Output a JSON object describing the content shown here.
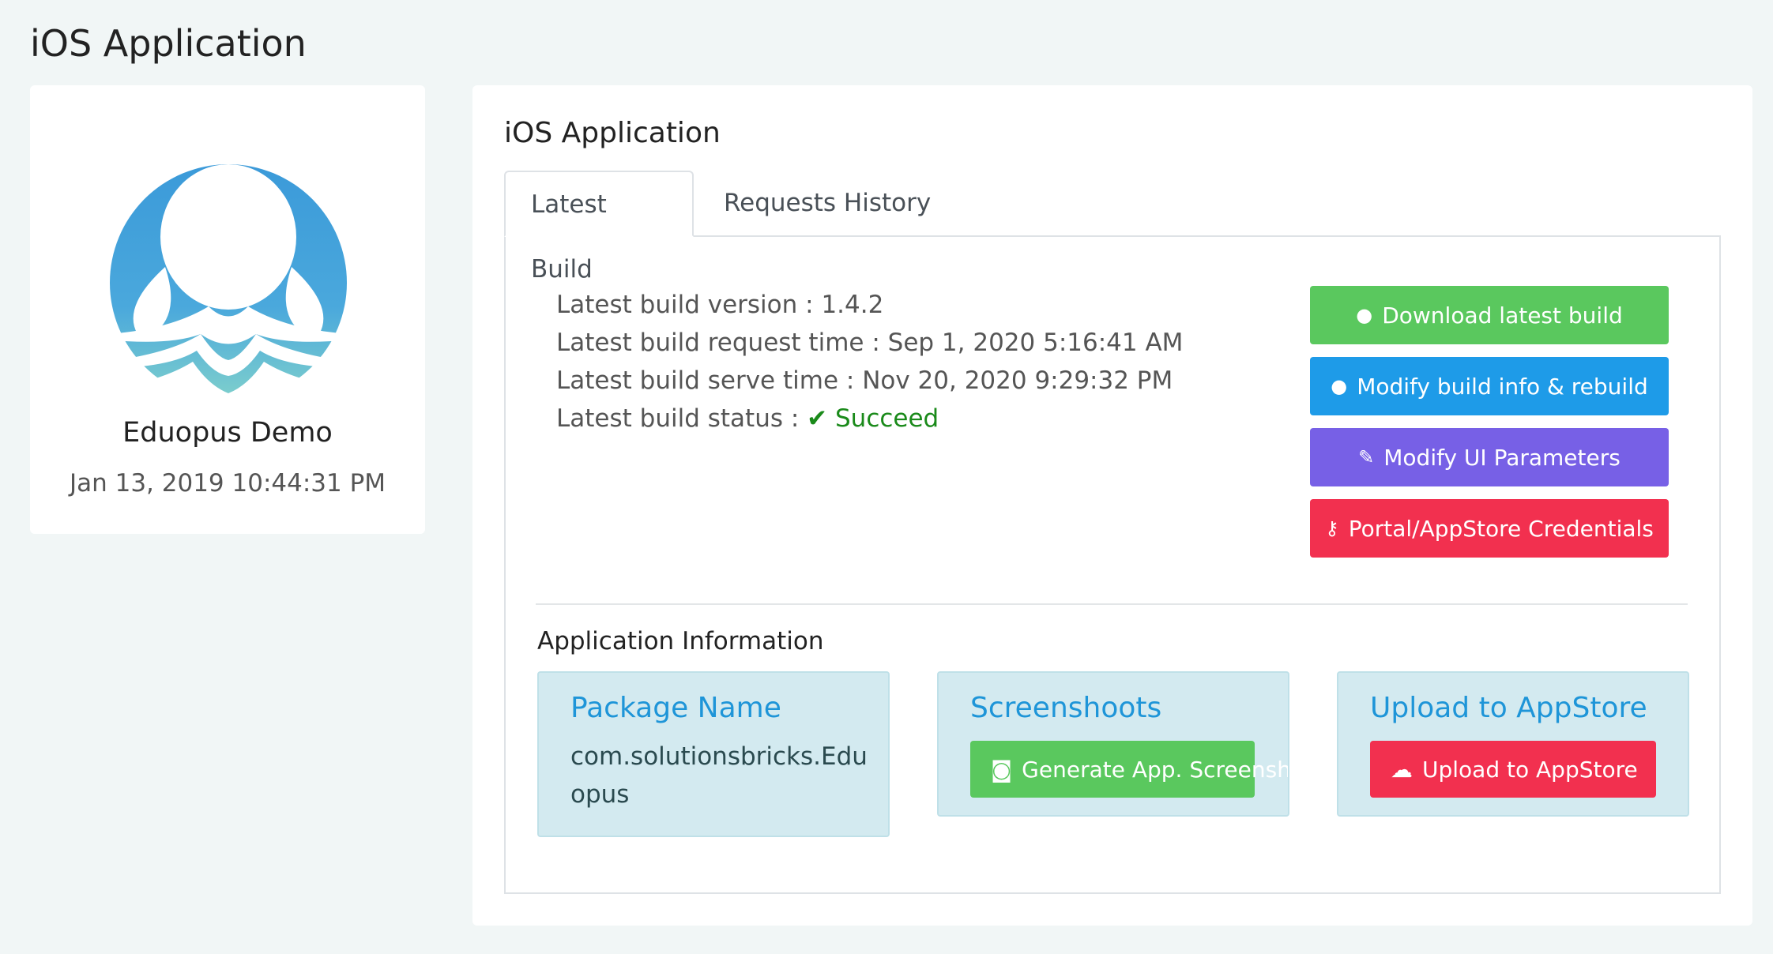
{
  "page": {
    "title": "iOS Application"
  },
  "profile": {
    "name": "Eduopus Demo",
    "date": "Jan 13, 2019 10:44:31 PM"
  },
  "main": {
    "title": "iOS Application",
    "tabs": [
      {
        "label": "Latest Build",
        "active": true
      },
      {
        "label": "Requests History",
        "active": false
      }
    ],
    "build": {
      "version_label": "Latest build version :",
      "version": "1.4.2",
      "request_time_label": "Latest build request time :",
      "request_time": "Sep 1, 2020 5:16:41 AM",
      "serve_time_label": "Latest build serve time :",
      "serve_time": "Nov 20, 2020 9:29:32 PM",
      "status_label": "Latest build status :",
      "status": "Succeed"
    },
    "actions": [
      {
        "label": "Download latest build",
        "icon": "apple-icon",
        "color": "#5ac85e"
      },
      {
        "label": "Modify build info & rebuild",
        "icon": "apple-icon",
        "color": "#1e9be8"
      },
      {
        "label": "Modify UI Parameters",
        "icon": "brush-icon",
        "color": "#7760e6"
      },
      {
        "label": "Portal/AppStore Credentials",
        "icon": "key-icon",
        "color": "#f2304f"
      }
    ],
    "app_info": {
      "title": "Application Information",
      "package": {
        "title": "Package Name",
        "value": "com.solutionsbricks.Eduopus"
      },
      "screenshots": {
        "title": "Screenshoots",
        "button": "Generate App. Screenshot",
        "icon": "camera-icon",
        "color": "#5ac85e"
      },
      "upload": {
        "title": "Upload to AppStore",
        "button": "Upload to AppStore",
        "icon": "cloud-upload-icon",
        "color": "#f2304f"
      }
    }
  }
}
